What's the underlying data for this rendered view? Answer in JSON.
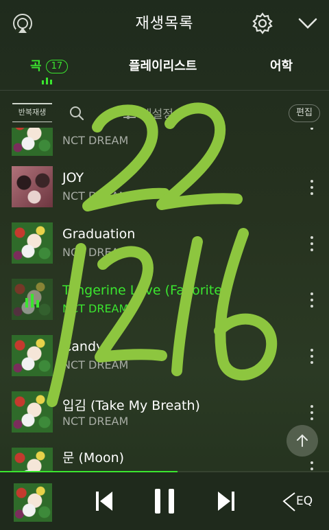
{
  "header": {
    "title": "재생목록"
  },
  "tabs": [
    {
      "label": "곡",
      "count": "17",
      "active": true
    },
    {
      "label": "플레이리스트",
      "active": false
    },
    {
      "label": "어학",
      "active": false
    }
  ],
  "toolbar": {
    "repeat_label": "반복재생",
    "sort_label": "내설정순",
    "edit_label": "편집"
  },
  "songs": [
    {
      "title": "",
      "artist": "NCT DREAM"
    },
    {
      "title": "JOY",
      "artist": "NCT DREAM"
    },
    {
      "title": "Graduation",
      "artist": "NCT DREAM"
    },
    {
      "title": "Tangerine Love (Favorite)",
      "artist": "NCT DREAM",
      "playing": true
    },
    {
      "title": "Candy",
      "artist": "NCT DREAM"
    },
    {
      "title": "입김 (Take My Breath)",
      "artist": "NCT DREAM"
    },
    {
      "title": "문 (Moon)",
      "artist": ""
    }
  ],
  "player": {
    "eq_label": "EQ",
    "progress": 0.54
  },
  "colors": {
    "accent": "#3be62f",
    "handwriting": "#8dc63f"
  },
  "icons": [
    "airplay-icon",
    "gear-icon",
    "chevron-down-icon",
    "search-icon",
    "sort-icon",
    "more-icon",
    "previous-icon",
    "pause-icon",
    "next-icon",
    "eq-icon",
    "arrow-up-icon"
  ]
}
